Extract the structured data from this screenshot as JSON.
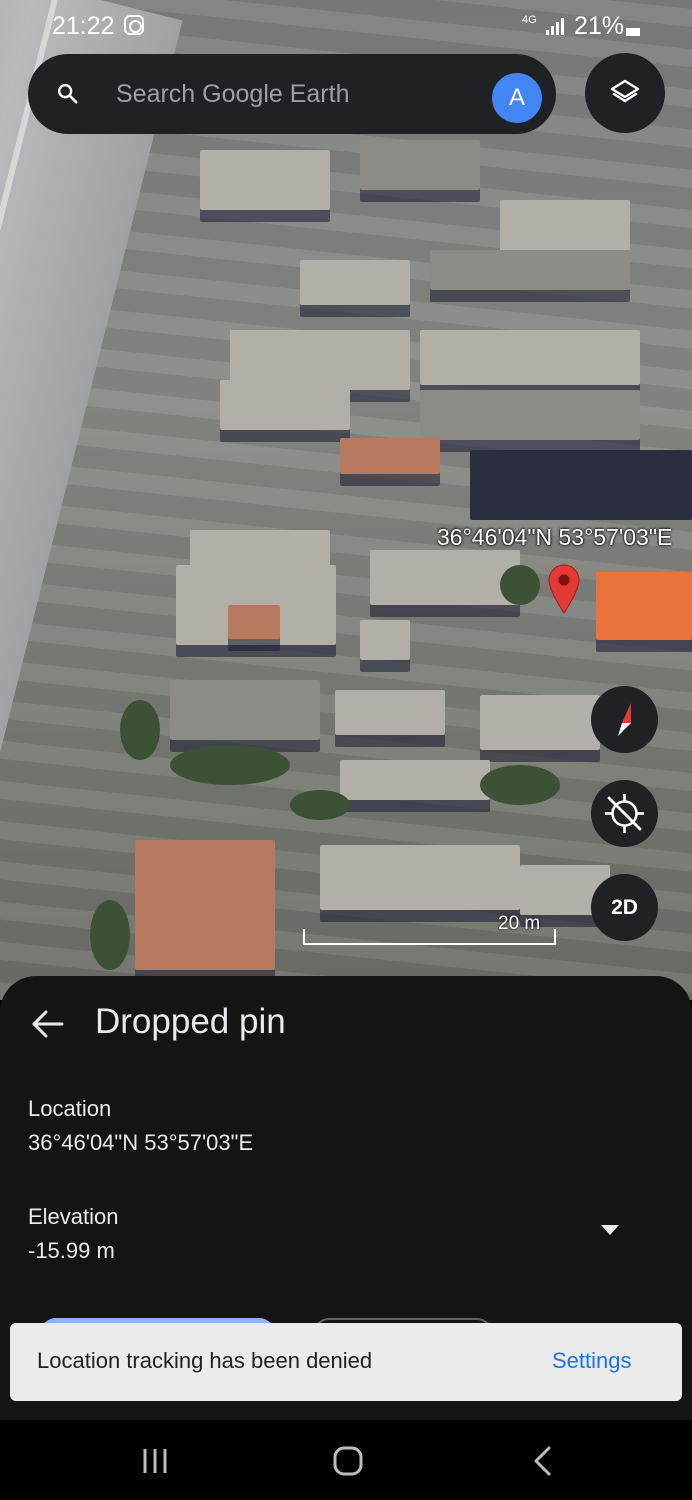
{
  "status_bar": {
    "time": "21:22",
    "network": "4G",
    "battery": "21%"
  },
  "search": {
    "placeholder": "Search Google Earth",
    "avatar_letter": "A"
  },
  "map": {
    "pin_coordinates": "36°46'04\"N 53°57'03\"E",
    "view_mode_label": "2D",
    "scale_label": "20 m",
    "pin_color": "#e53935"
  },
  "sheet": {
    "title": "Dropped pin",
    "location_label": "Location",
    "location_value": "36°46'04\"N 53°57'03\"E",
    "elevation_label": "Elevation",
    "elevation_value": "-15.99 m"
  },
  "snackbar": {
    "message": "Location tracking has been denied",
    "action_label": "Settings"
  },
  "colors": {
    "accent": "#1a73e8",
    "avatar": "#4285f4",
    "sheet_background": "#141414"
  },
  "icons": {
    "search": "search-icon",
    "layers": "layers-icon",
    "compass": "compass-icon",
    "location": "location-off-icon",
    "back": "back-arrow-icon",
    "dropdown": "chevron-down-icon"
  }
}
